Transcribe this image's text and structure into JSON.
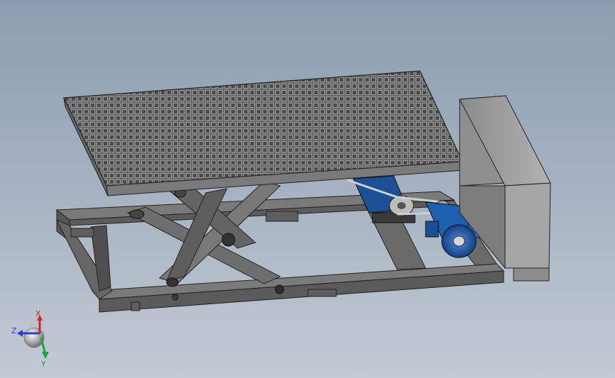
{
  "view": {
    "background_top": "#8b9db0",
    "background_bottom": "#c2cad4"
  },
  "triad": {
    "x_label": "X",
    "y_label": "Y",
    "z_label": "Z",
    "x_color": "#d0232a",
    "y_color": "#1fa33a",
    "z_color": "#2a3fd0"
  },
  "model": {
    "parts": [
      "grated-platform",
      "scissor-arms",
      "base-frame",
      "hydraulic-motor",
      "gear-reducer",
      "belt-drive",
      "control-cabinet"
    ],
    "metal_color": "#6b6b6b",
    "motor_color": "#1f5fb0",
    "cabinet_color": "#a6a6a6"
  }
}
